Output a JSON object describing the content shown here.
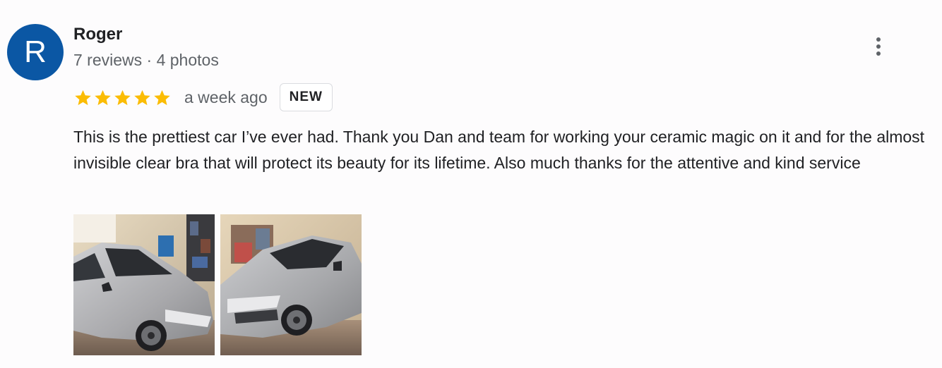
{
  "reviewer": {
    "avatar_letter": "R",
    "avatar_color": "#0b57a4",
    "name": "Roger",
    "meta": "7 reviews · 4 photos"
  },
  "review": {
    "rating": 5,
    "max_rating": 5,
    "star_color": "#fbbc04",
    "date": "a week ago",
    "badge": "NEW",
    "text": "This is the prettiest car I’ve ever had. Thank you Dan and team for working your ceramic magic on it and for the almost invisible clear bra that will protect its beauty for its lifetime. Also much thanks for the attentive and kind service"
  },
  "photos": [
    {
      "subject": "silver car in garage, front-left view"
    },
    {
      "subject": "silver car in garage, front view"
    }
  ],
  "icons": {
    "more_menu": "more-vert-icon",
    "star": "star-icon"
  }
}
